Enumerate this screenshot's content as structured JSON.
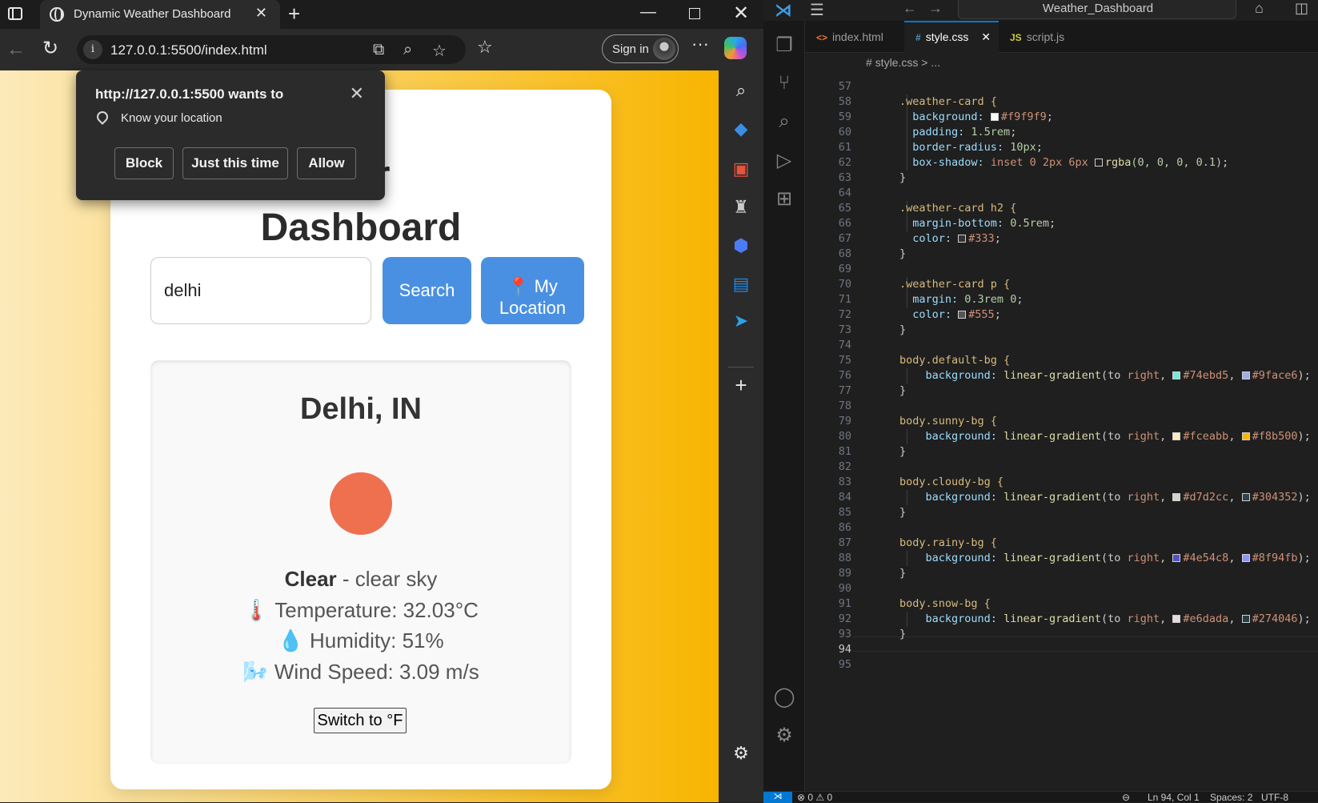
{
  "browser": {
    "tab_title": "Dynamic Weather Dashboard",
    "url": "127.0.0.1:5500/index.html",
    "signin_label": "Sign in",
    "permission": {
      "title": "http://127.0.0.1:5500 wants to",
      "description": "Know your location",
      "block_label": "Block",
      "just_this_time_label": "Just this time",
      "allow_label": "Allow"
    }
  },
  "page": {
    "title_line1": "ather",
    "title_line2": "Dashboard",
    "search_value": "delhi",
    "search_label": "Search",
    "location_line1": "📍 My",
    "location_line2": "Location",
    "weather": {
      "city": "Delhi, IN",
      "condition_main": "Clear",
      "condition_desc": " - clear sky",
      "temperature": "🌡️ Temperature: 32.03°C",
      "humidity": "💧 Humidity: 51%",
      "wind": "🌬️ Wind Speed: 3.09 m/s",
      "toggle_label": "Switch to °F"
    },
    "background_gradient": [
      "#fceabb",
      "#f8b500"
    ]
  },
  "vscode": {
    "command_center": "Weather_Dashboard",
    "tabs": [
      {
        "icon": "<>",
        "label": "index.html"
      },
      {
        "icon": "#",
        "label": "style.css"
      },
      {
        "icon": "JS",
        "label": "script.js"
      }
    ],
    "breadcrumb": "# style.css > ...",
    "status": {
      "problems": "⊗ 0 ⚠ 0",
      "position": "Ln 94, Col 1",
      "spaces": "Spaces: 2",
      "encoding": "UTF-8"
    },
    "code": {
      "line_numbers": [
        "57",
        "58",
        "59",
        "60",
        "61",
        "62",
        "63",
        "64",
        "65",
        "66",
        "67",
        "68",
        "69",
        "70",
        "71",
        "72",
        "73",
        "74",
        "75",
        "76",
        "77",
        "78",
        "79",
        "80",
        "81",
        "82",
        "83",
        "84",
        "85",
        "86",
        "87",
        "88",
        "89",
        "90",
        "91",
        "92",
        "93",
        "94",
        "95"
      ],
      "l58": ".weather-card {",
      "l59a": "background: ",
      "l59b": "#f9f9f9",
      "l60a": "padding: ",
      "l60b": "1.5rem",
      "l61a": "border-radius: ",
      "l61b": "10px",
      "l62a": "box-shadow: ",
      "l62b": "inset 0 2px 6px ",
      "l62c": "rgba",
      "l62d": "(0, 0, 0, 0.1)",
      "l65": ".weather-card h2 {",
      "l66a": "margin-bottom: ",
      "l66b": "0.5rem",
      "l67a": "color: ",
      "l67b": "#333",
      "l70": ".weather-card p {",
      "l71a": "margin: ",
      "l71b": "0.3rem 0",
      "l72a": "color: ",
      "l72b": "#555",
      "l75": "body.default-bg {",
      "l76c1": "#74ebd5",
      "l76c2": "#9face6",
      "l79": "body.sunny-bg {",
      "l80c1": "#fceabb",
      "l80c2": "#f8b500",
      "l83": "body.cloudy-bg {",
      "l84c1": "#d7d2cc",
      "l84c2": "#304352",
      "l87": "body.rainy-bg {",
      "l88c1": "#4e54c8",
      "l88c2": "#8f94fb",
      "l91": "body.snow-bg {",
      "l92c1": "#e6dada",
      "l92c2": "#274046",
      "grad_prop": "background: ",
      "grad_fn": "linear-gradient",
      "grad_open": "(to ",
      "grad_dir": "right",
      "close": "}"
    }
  }
}
